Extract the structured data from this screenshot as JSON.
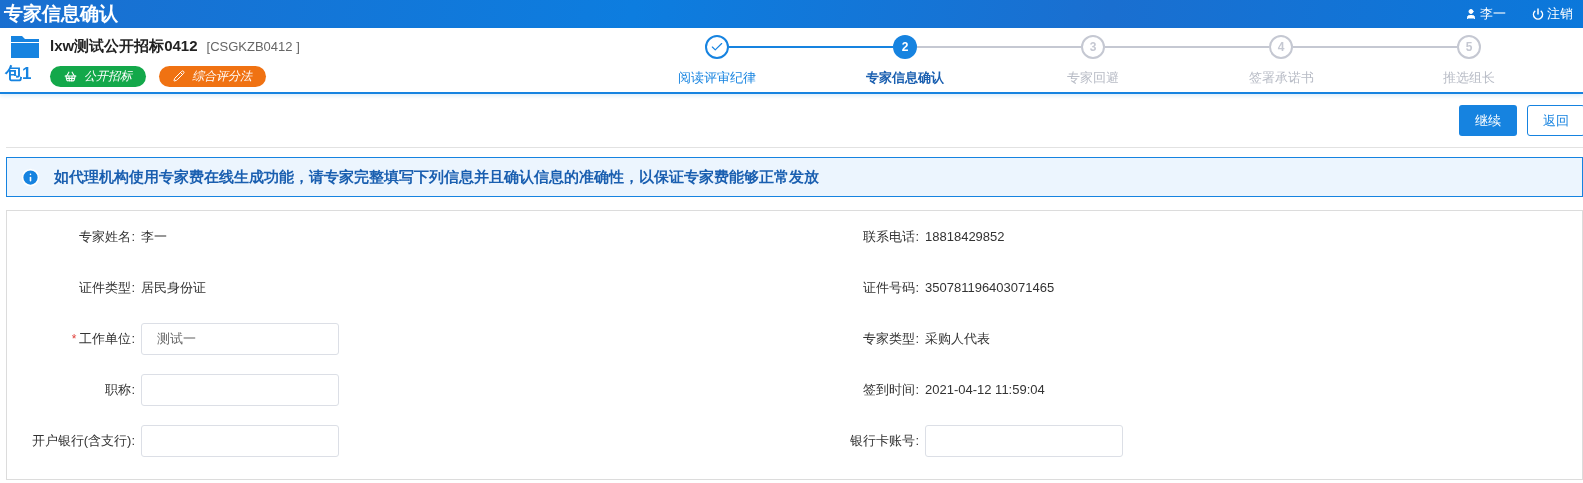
{
  "top_bar": {
    "title": "专家信息确认",
    "user": "李一",
    "logout": "注销"
  },
  "project": {
    "package": "包1",
    "name": "lxw测试公开招标0412",
    "code": "[CSGKZB0412 ]",
    "tags": [
      {
        "label": "公开招标",
        "color": "#13a84a",
        "kind": "basket"
      },
      {
        "label": "综合评分法",
        "color": "#f07212",
        "kind": "pen"
      }
    ]
  },
  "steps": [
    {
      "label": "阅读评审纪律",
      "done": true,
      "selected": false
    },
    {
      "number": "2",
      "label": "专家信息确认",
      "done": false,
      "selected": true
    },
    {
      "number": "3",
      "label": "专家回避",
      "done": false,
      "selected": false
    },
    {
      "number": "4",
      "label": "签署承诺书",
      "done": false,
      "selected": false
    },
    {
      "number": "5",
      "label": "推选组长",
      "done": false,
      "selected": false
    }
  ],
  "required_mark": "*",
  "actions": [
    {
      "label": "继续",
      "kind": "primary"
    },
    {
      "label": "返回",
      "kind": "secondary"
    }
  ],
  "notice": "如代理机构使用专家费在线生成功能，请专家完整填写下列信息并且确认信息的准确性，以保证专家费能够正常发放",
  "form": {
    "left": [
      {
        "label": "专家姓名:",
        "kind": "text",
        "value": "李一",
        "required": false
      },
      {
        "label": "证件类型:",
        "kind": "text",
        "value": "居民身份证",
        "required": false
      },
      {
        "label": "工作单位:",
        "kind": "input",
        "value": "测试一",
        "required": true
      },
      {
        "label": "职称:",
        "kind": "input",
        "required": false
      },
      {
        "label": "开户银行(含支行):",
        "kind": "input",
        "required": false
      }
    ],
    "right": [
      {
        "label": "联系电话:",
        "kind": "text",
        "value": "18818429852",
        "required": false
      },
      {
        "label": "证件号码:",
        "kind": "text",
        "value": "350781196403071465",
        "required": false
      },
      {
        "label": "专家类型:",
        "kind": "text",
        "value": "采购人代表",
        "required": false
      },
      {
        "label": "签到时间:",
        "kind": "text",
        "value": "2021-04-12 11:59:04",
        "required": false
      },
      {
        "label": "银行卡账号:",
        "kind": "input",
        "required": false
      }
    ]
  }
}
